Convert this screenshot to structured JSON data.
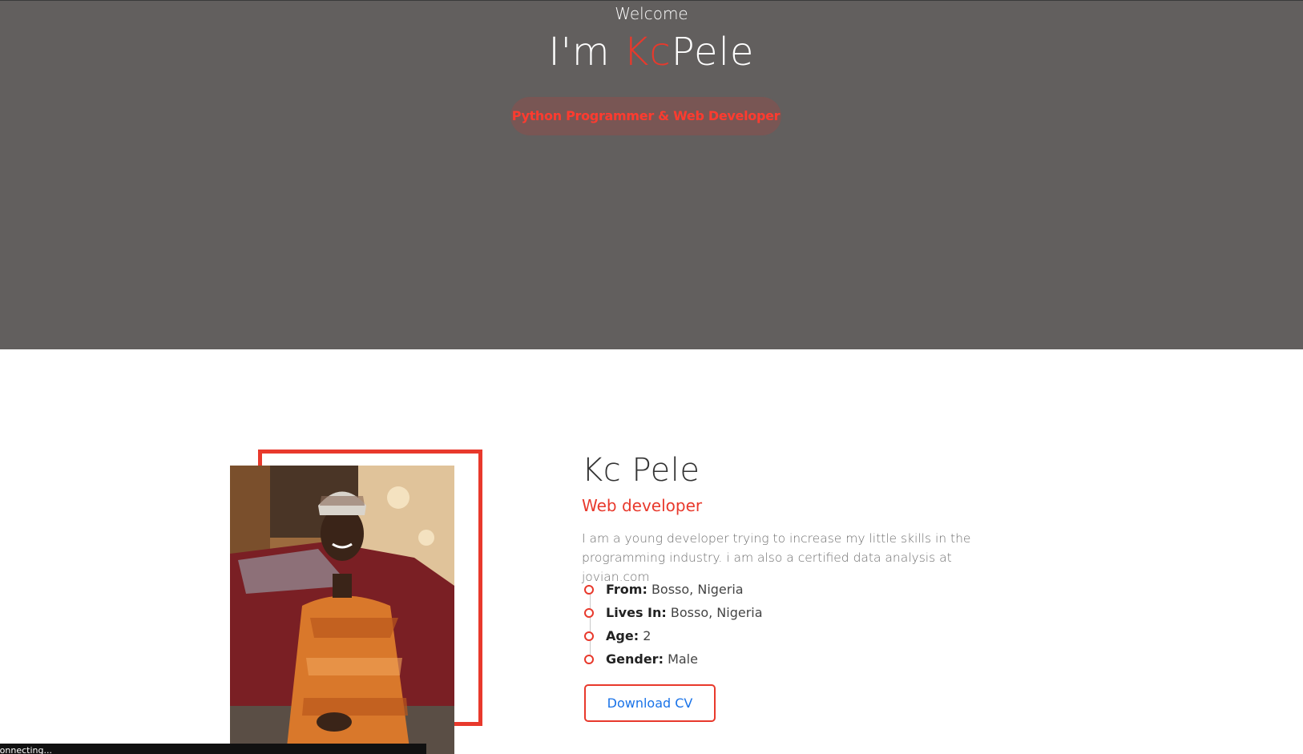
{
  "hero": {
    "welcome": "Welcome",
    "headline_prefix": "I'm ",
    "headline_accent": "Kc",
    "headline_suffix": "Pele",
    "role": "Python Programmer & Web Developer"
  },
  "about": {
    "name": "Kc Pele",
    "subtitle": "Web developer",
    "bio": "I am a young developer trying to increase my little skills in the programming industry. i am also a certified data analysis at jovian.com",
    "facts": [
      {
        "key": "From:",
        "value": "Bosso, Nigeria"
      },
      {
        "key": "Lives In:",
        "value": "Bosso, Nigeria"
      },
      {
        "key": "Age:",
        "value": "2"
      },
      {
        "key": "Gender:",
        "value": "Male"
      }
    ],
    "download_label": "Download CV"
  },
  "status_bar": {
    "text": "Connecting..."
  },
  "colors": {
    "accent": "#e8392c",
    "hero_bg": "#625f5e",
    "link_blue": "#1a73e8"
  }
}
